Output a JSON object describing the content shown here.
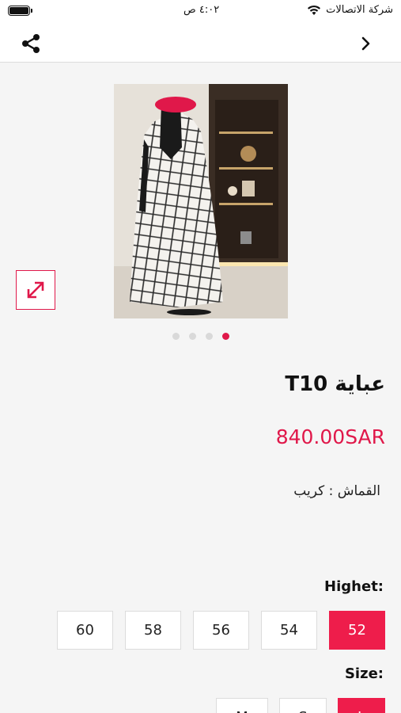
{
  "status_bar": {
    "carrier": "شركة الاتصالات",
    "time": "٤:٠٢ ص"
  },
  "colors": {
    "accent": "#ee1d4b"
  },
  "product": {
    "title": "عباية T10",
    "price": "840.00SAR",
    "fabric": "القماش : كريب",
    "gallery_index": 4,
    "gallery_count": 4
  },
  "height_option": {
    "label": "Highet:",
    "options": [
      "52",
      "54",
      "56",
      "58",
      "60"
    ],
    "selected": "52"
  },
  "size_option": {
    "label": "Size:",
    "options": [
      "L",
      "S",
      "M"
    ],
    "selected": "L"
  },
  "icons": {
    "share": "share-icon",
    "back": "chevron-right-icon",
    "expand": "expand-icon"
  }
}
